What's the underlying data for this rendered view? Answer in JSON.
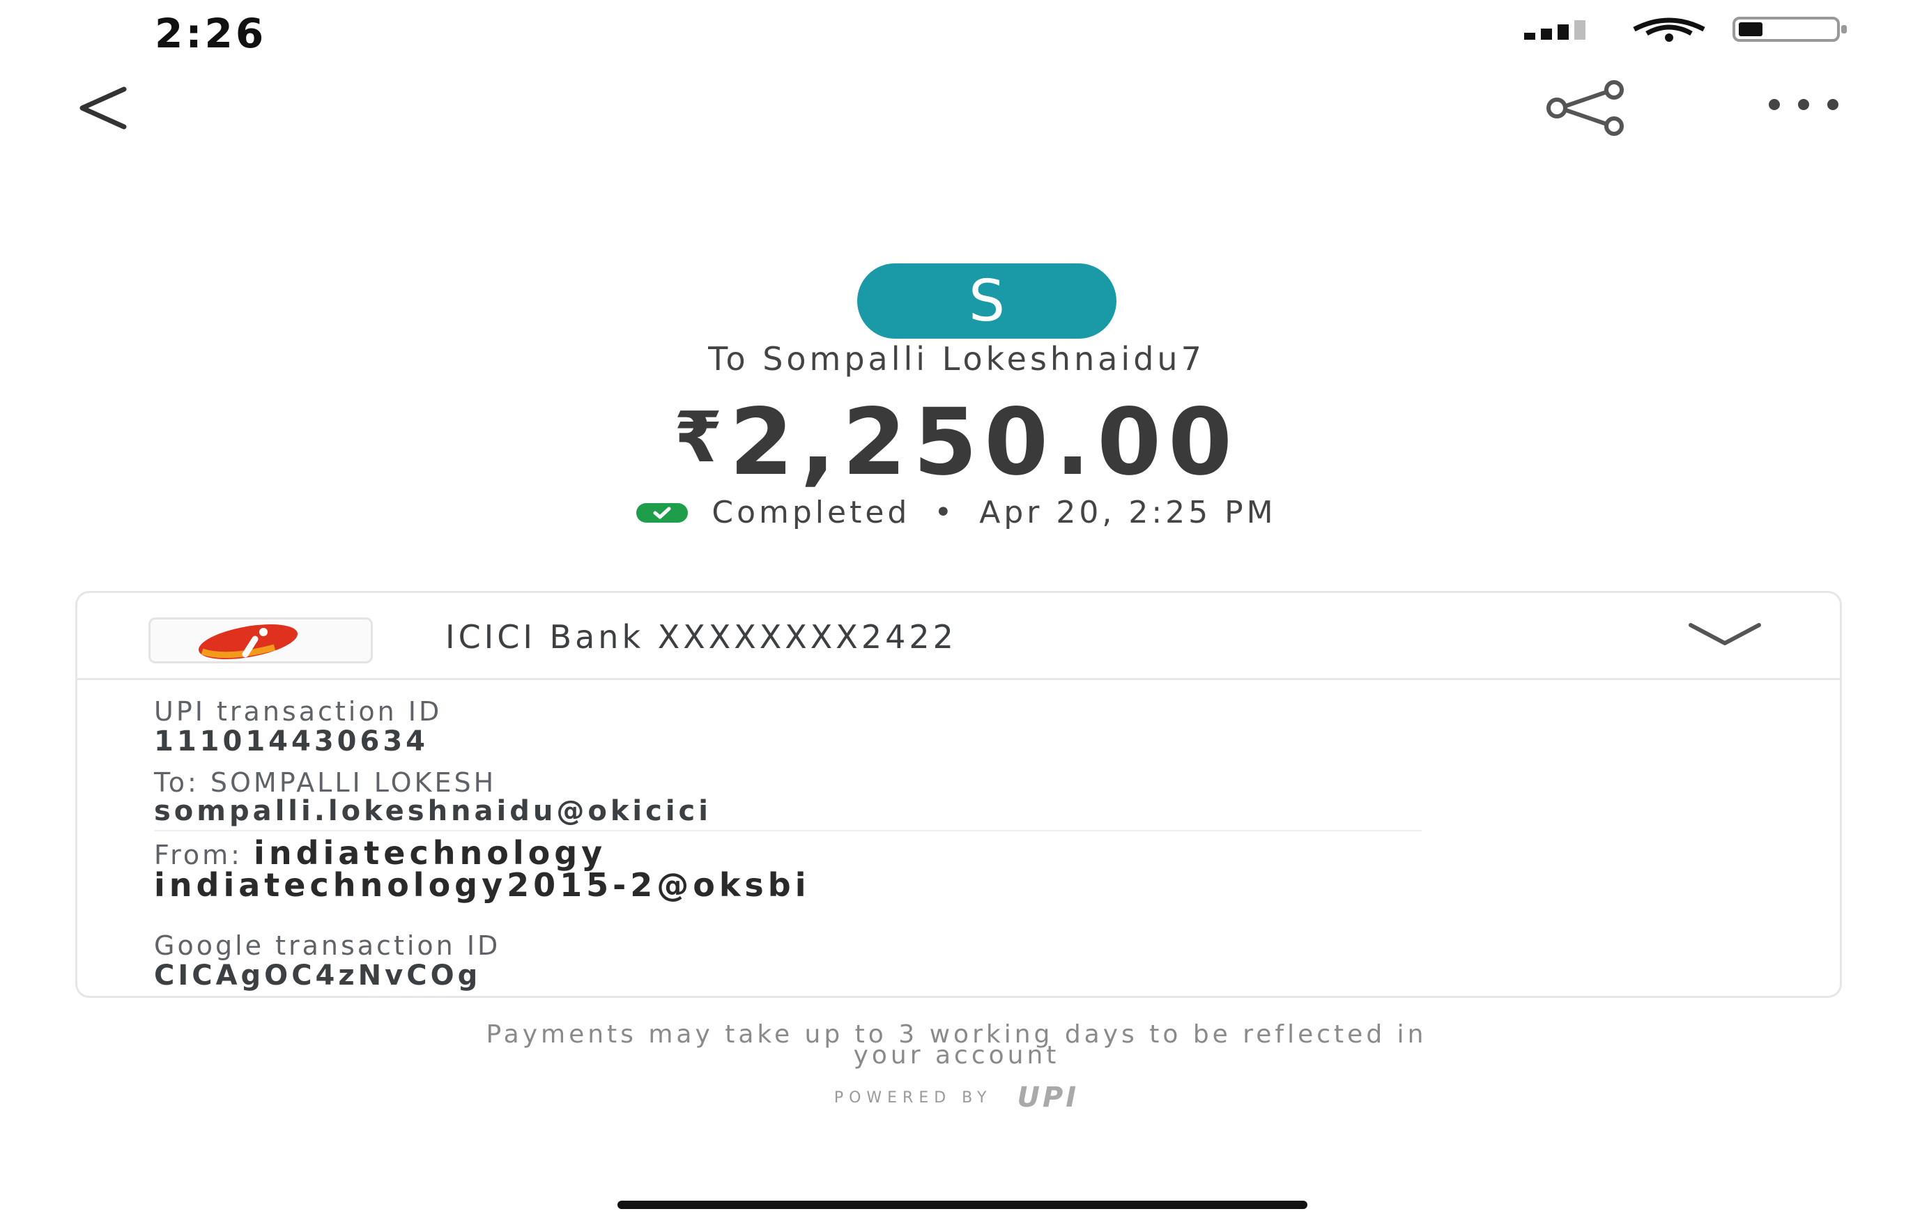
{
  "status_bar": {
    "time": "2:26",
    "icons": [
      "signal-icon",
      "wifi-icon",
      "battery-icon"
    ]
  },
  "top_bar": {
    "back_icon": "back-arrow-icon",
    "share_icon": "share-icon",
    "more_icon": "more-options-icon"
  },
  "header": {
    "avatar_letter": "S",
    "avatar_color": "#1a9aa6",
    "recipient_text": "To Sompalli Lokeshnaidu7",
    "currency_symbol": "₹",
    "amount": "2,250.00",
    "status": "Completed",
    "separator": "•",
    "datetime": "Apr 20, 2:25 PM",
    "status_color": "#1e9e4a"
  },
  "account_card": {
    "bank_name": "ICICI Bank XXXXXXXX2422",
    "bank_logo_icon": "icici-bank-logo-icon",
    "expand_icon": "chevron-down-icon",
    "upi_label": "UPI transaction ID",
    "upi_id": "111014430634",
    "to_label": "To: SOMPALLI LOKESH",
    "to_vpa": "sompalli.lokeshnaidu@okicici",
    "from_label": "From:",
    "from_name": "indiatechnology",
    "from_vpa": "indiatechnology2015-2@oksbi",
    "google_label": "Google transaction ID",
    "google_id": "CICAgOC4zNvCOg"
  },
  "footer": {
    "note_line1": "Payments may take up to 3 working days to be reflected in",
    "note_line2": "your account",
    "powered_by": "POWERED BY",
    "upi_logo_text": "UPI"
  }
}
